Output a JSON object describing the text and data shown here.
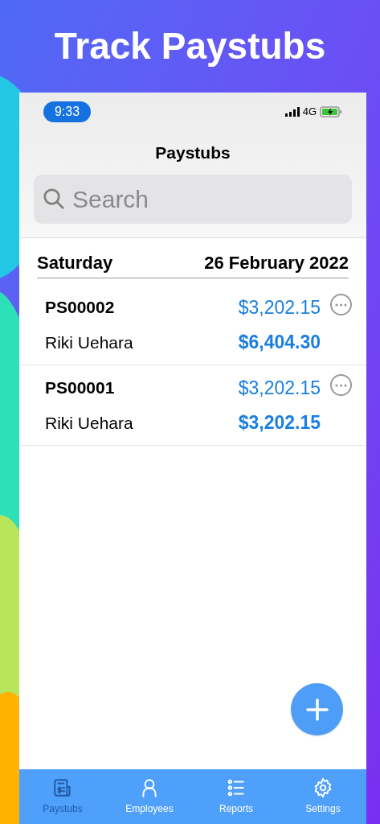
{
  "headline": "Track Paystubs",
  "status_bar": {
    "time": "9:33",
    "network": "4G"
  },
  "nav_title": "Paystubs",
  "search": {
    "placeholder": "Search"
  },
  "section": {
    "day": "Saturday",
    "date": "26 February 2022"
  },
  "paystubs": [
    {
      "id": "PS00002",
      "employee": "Riki Uehara",
      "amount": "$3,202.15",
      "total": "$6,404.30"
    },
    {
      "id": "PS00001",
      "employee": "Riki Uehara",
      "amount": "$3,202.15",
      "total": "$3,202.15"
    }
  ],
  "tabs": [
    {
      "kind": "paystubs",
      "label": "Paystubs",
      "selected": true
    },
    {
      "kind": "employees",
      "label": "Employees",
      "selected": false
    },
    {
      "kind": "reports",
      "label": "Reports",
      "selected": false
    },
    {
      "kind": "settings",
      "label": "Settings",
      "selected": false
    }
  ]
}
